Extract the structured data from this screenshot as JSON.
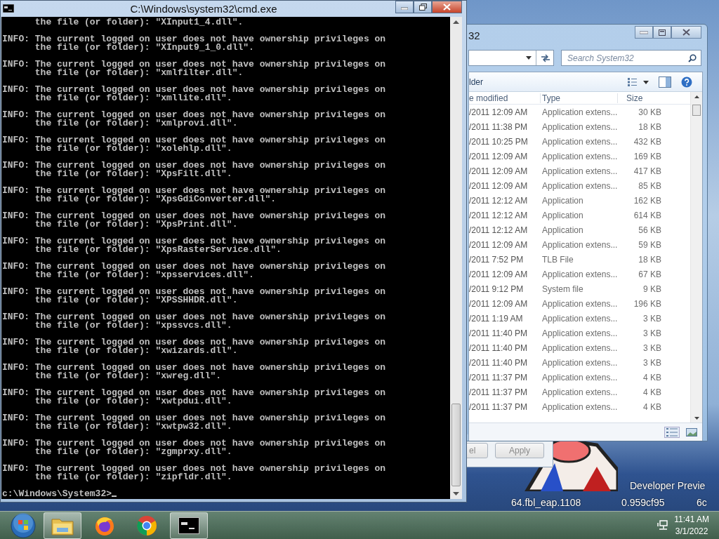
{
  "cmd_window": {
    "title": "C:\\Windows\\system32\\cmd.exe",
    "output": [
      {
        "lines": [
          "      the file (or folder): \"XInput1_4.dll\"."
        ]
      },
      {
        "lines": [
          "INFO: The current logged on user does not have ownership privileges on",
          "      the file (or folder): \"XInput9_1_0.dll\"."
        ]
      },
      {
        "lines": [
          "INFO: The current logged on user does not have ownership privileges on",
          "      the file (or folder): \"xmlfilter.dll\"."
        ]
      },
      {
        "lines": [
          "INFO: The current logged on user does not have ownership privileges on",
          "      the file (or folder): \"xmllite.dll\"."
        ]
      },
      {
        "lines": [
          "INFO: The current logged on user does not have ownership privileges on",
          "      the file (or folder): \"xmlprovi.dll\"."
        ]
      },
      {
        "lines": [
          "INFO: The current logged on user does not have ownership privileges on",
          "      the file (or folder): \"xolehlp.dll\"."
        ]
      },
      {
        "lines": [
          "INFO: The current logged on user does not have ownership privileges on",
          "      the file (or folder): \"XpsFilt.dll\"."
        ]
      },
      {
        "lines": [
          "INFO: The current logged on user does not have ownership privileges on",
          "      the file (or folder): \"XpsGdiConverter.dll\"."
        ]
      },
      {
        "lines": [
          "INFO: The current logged on user does not have ownership privileges on",
          "      the file (or folder): \"XpsPrint.dll\"."
        ]
      },
      {
        "lines": [
          "INFO: The current logged on user does not have ownership privileges on",
          "      the file (or folder): \"XpsRasterService.dll\"."
        ]
      },
      {
        "lines": [
          "INFO: The current logged on user does not have ownership privileges on",
          "      the file (or folder): \"xpsservices.dll\"."
        ]
      },
      {
        "lines": [
          "INFO: The current logged on user does not have ownership privileges on",
          "      the file (or folder): \"XPSSHHDR.dll\"."
        ]
      },
      {
        "lines": [
          "INFO: The current logged on user does not have ownership privileges on",
          "      the file (or folder): \"xpssvcs.dll\"."
        ]
      },
      {
        "lines": [
          "INFO: The current logged on user does not have ownership privileges on",
          "      the file (or folder): \"xwizards.dll\"."
        ]
      },
      {
        "lines": [
          "INFO: The current logged on user does not have ownership privileges on",
          "      the file (or folder): \"xwreg.dll\"."
        ]
      },
      {
        "lines": [
          "INFO: The current logged on user does not have ownership privileges on",
          "      the file (or folder): \"xwtpdui.dll\"."
        ]
      },
      {
        "lines": [
          "INFO: The current logged on user does not have ownership privileges on",
          "      the file (or folder): \"xwtpw32.dll\"."
        ]
      },
      {
        "lines": [
          "INFO: The current logged on user does not have ownership privileges on",
          "      the file (or folder): \"zgmprxy.dll\"."
        ]
      },
      {
        "lines": [
          "INFO: The current logged on user does not have ownership privileges on",
          "      the file (or folder): \"zipfldr.dll\"."
        ]
      }
    ],
    "prompt": "c:\\Windows\\System32>"
  },
  "explorer_window": {
    "title": "32",
    "search": {
      "placeholder": "Search System32"
    },
    "toolbar_label": "lder",
    "columns": [
      "e modified",
      "Type",
      "Size"
    ],
    "rows": [
      [
        "/2011 12:09 AM",
        "Application extens...",
        "30 KB"
      ],
      [
        "/2011 11:38 PM",
        "Application extens...",
        "18 KB"
      ],
      [
        "/2011 10:25 PM",
        "Application extens...",
        "432 KB"
      ],
      [
        "/2011 12:09 AM",
        "Application extens...",
        "169 KB"
      ],
      [
        "/2011 12:09 AM",
        "Application extens...",
        "417 KB"
      ],
      [
        "/2011 12:09 AM",
        "Application extens...",
        "85 KB"
      ],
      [
        "/2011 12:12 AM",
        "Application",
        "162 KB"
      ],
      [
        "/2011 12:12 AM",
        "Application",
        "614 KB"
      ],
      [
        "/2011 12:12 AM",
        "Application",
        "56 KB"
      ],
      [
        "/2011 12:09 AM",
        "Application extens...",
        "59 KB"
      ],
      [
        "/2011 7:52 PM",
        "TLB File",
        "18 KB"
      ],
      [
        "/2011 12:09 AM",
        "Application extens...",
        "67 KB"
      ],
      [
        "/2011 9:12 PM",
        "System file",
        "9 KB"
      ],
      [
        "/2011 12:09 AM",
        "Application extens...",
        "196 KB"
      ],
      [
        "/2011 1:19 AM",
        "Application extens...",
        "3 KB"
      ],
      [
        "/2011 11:40 PM",
        "Application extens...",
        "3 KB"
      ],
      [
        "/2011 11:40 PM",
        "Application extens...",
        "3 KB"
      ],
      [
        "/2011 11:40 PM",
        "Application extens...",
        "3 KB"
      ],
      [
        "/2011 11:37 PM",
        "Application extens...",
        "4 KB"
      ],
      [
        "/2011 11:37 PM",
        "Application extens...",
        "4 KB"
      ],
      [
        "/2011 11:37 PM",
        "Application extens...",
        "4 KB"
      ]
    ]
  },
  "dialog": {
    "buttons": [
      "el",
      "Apply"
    ]
  },
  "desktop_text": [
    "Developer Previe",
    "64.fbl_eap.1108",
    "0.959cf95",
    "6c"
  ],
  "taskbar": {
    "buttons": [
      {
        "kind": "start",
        "running": false
      },
      {
        "kind": "explorer",
        "running": true
      },
      {
        "kind": "firefox",
        "running": false
      },
      {
        "kind": "chrome",
        "running": false
      },
      {
        "kind": "console",
        "running": true
      }
    ],
    "clock": {
      "time": "11:41 AM",
      "date": "3/1/2022"
    }
  }
}
